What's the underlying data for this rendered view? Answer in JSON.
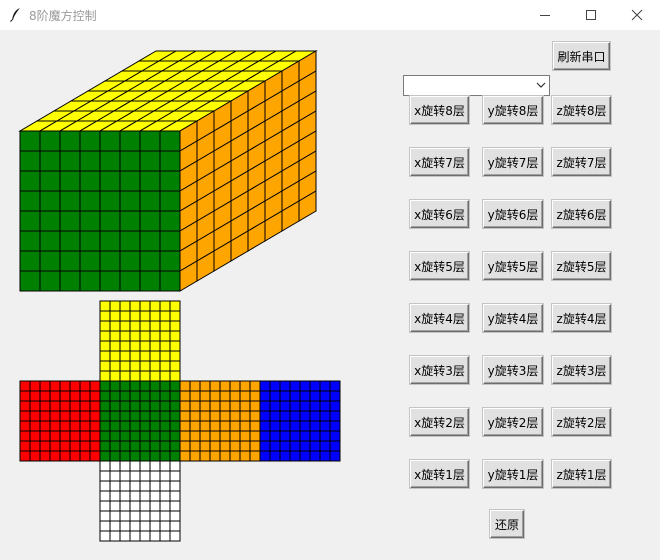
{
  "window": {
    "title": "8阶魔方控制"
  },
  "serial": {
    "selected": "",
    "refresh_label": "刷新串口"
  },
  "rotations": [
    {
      "x": "x旋转8层",
      "y": "y旋转8层",
      "z": "z旋转8层"
    },
    {
      "x": "x旋转7层",
      "y": "y旋转7层",
      "z": "z旋转7层"
    },
    {
      "x": "x旋转6层",
      "y": "y旋转6层",
      "z": "z旋转6层"
    },
    {
      "x": "x旋转5层",
      "y": "y旋转5层",
      "z": "z旋转5层"
    },
    {
      "x": "x旋转4层",
      "y": "y旋转4层",
      "z": "z旋转4层"
    },
    {
      "x": "x旋转3层",
      "y": "y旋转3层",
      "z": "z旋转3层"
    },
    {
      "x": "x旋转2层",
      "y": "y旋转2层",
      "z": "z旋转2层"
    },
    {
      "x": "x旋转1层",
      "y": "y旋转1层",
      "z": "z旋转1层"
    }
  ],
  "reset_label": "还原",
  "cube": {
    "order": 8,
    "colors": {
      "up": "#ffff00",
      "front": "#008000",
      "right": "#ffa500",
      "left": "#ff0000",
      "back": "#0000ff",
      "down": "#ffffff"
    }
  },
  "icons": {
    "app": "feather-icon",
    "minimize": "minimize-icon",
    "maximize": "maximize-icon",
    "close": "close-icon",
    "dropdown": "chevron-down-icon"
  }
}
